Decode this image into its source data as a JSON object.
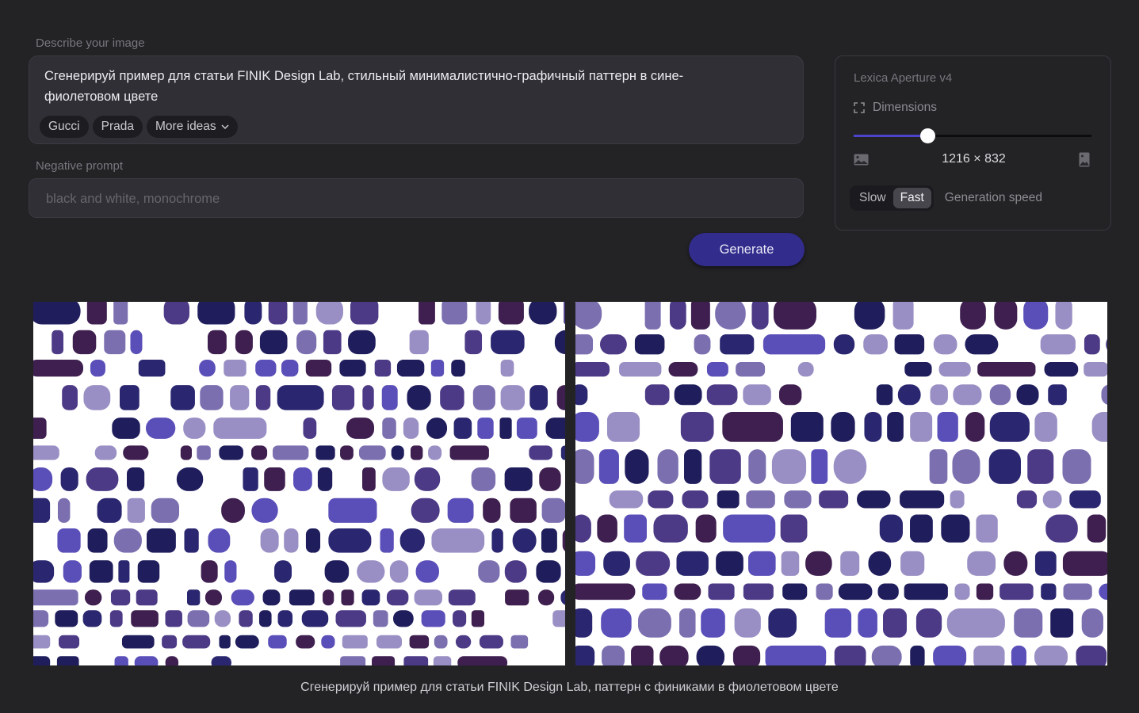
{
  "prompt": {
    "label": "Describe your image",
    "text": "Сгенерируй пример для статьи FINIK Design Lab, стильный минималистично-графичный паттерн в сине-фиолетовом цвете",
    "chips": [
      "Gucci",
      "Prada",
      "More ideas"
    ]
  },
  "negative": {
    "label": "Negative prompt",
    "placeholder": "black and white, monochrome",
    "value": ""
  },
  "generate_label": "Generate",
  "settings": {
    "model": "Lexica Aperture v4",
    "dimensions_label": "Dimensions",
    "dimensions_value": "1216 × 832",
    "slider_fraction": 0.31,
    "speed_options": [
      "Slow",
      "Fast"
    ],
    "speed_selected": "Fast",
    "speed_label": "Generation speed"
  },
  "colors": {
    "accent": "#4b43c9",
    "button": "#322c8c",
    "palette": [
      "#1f1d5c",
      "#2a2770",
      "#4c3a86",
      "#5a4fb8",
      "#9a8fc4",
      "#7b6fb0",
      "#3e1f4f"
    ]
  },
  "caption": "Сгенерируй пример для статьи FINIK Design Lab, паттерн с финиками в фиолетовом цвете"
}
